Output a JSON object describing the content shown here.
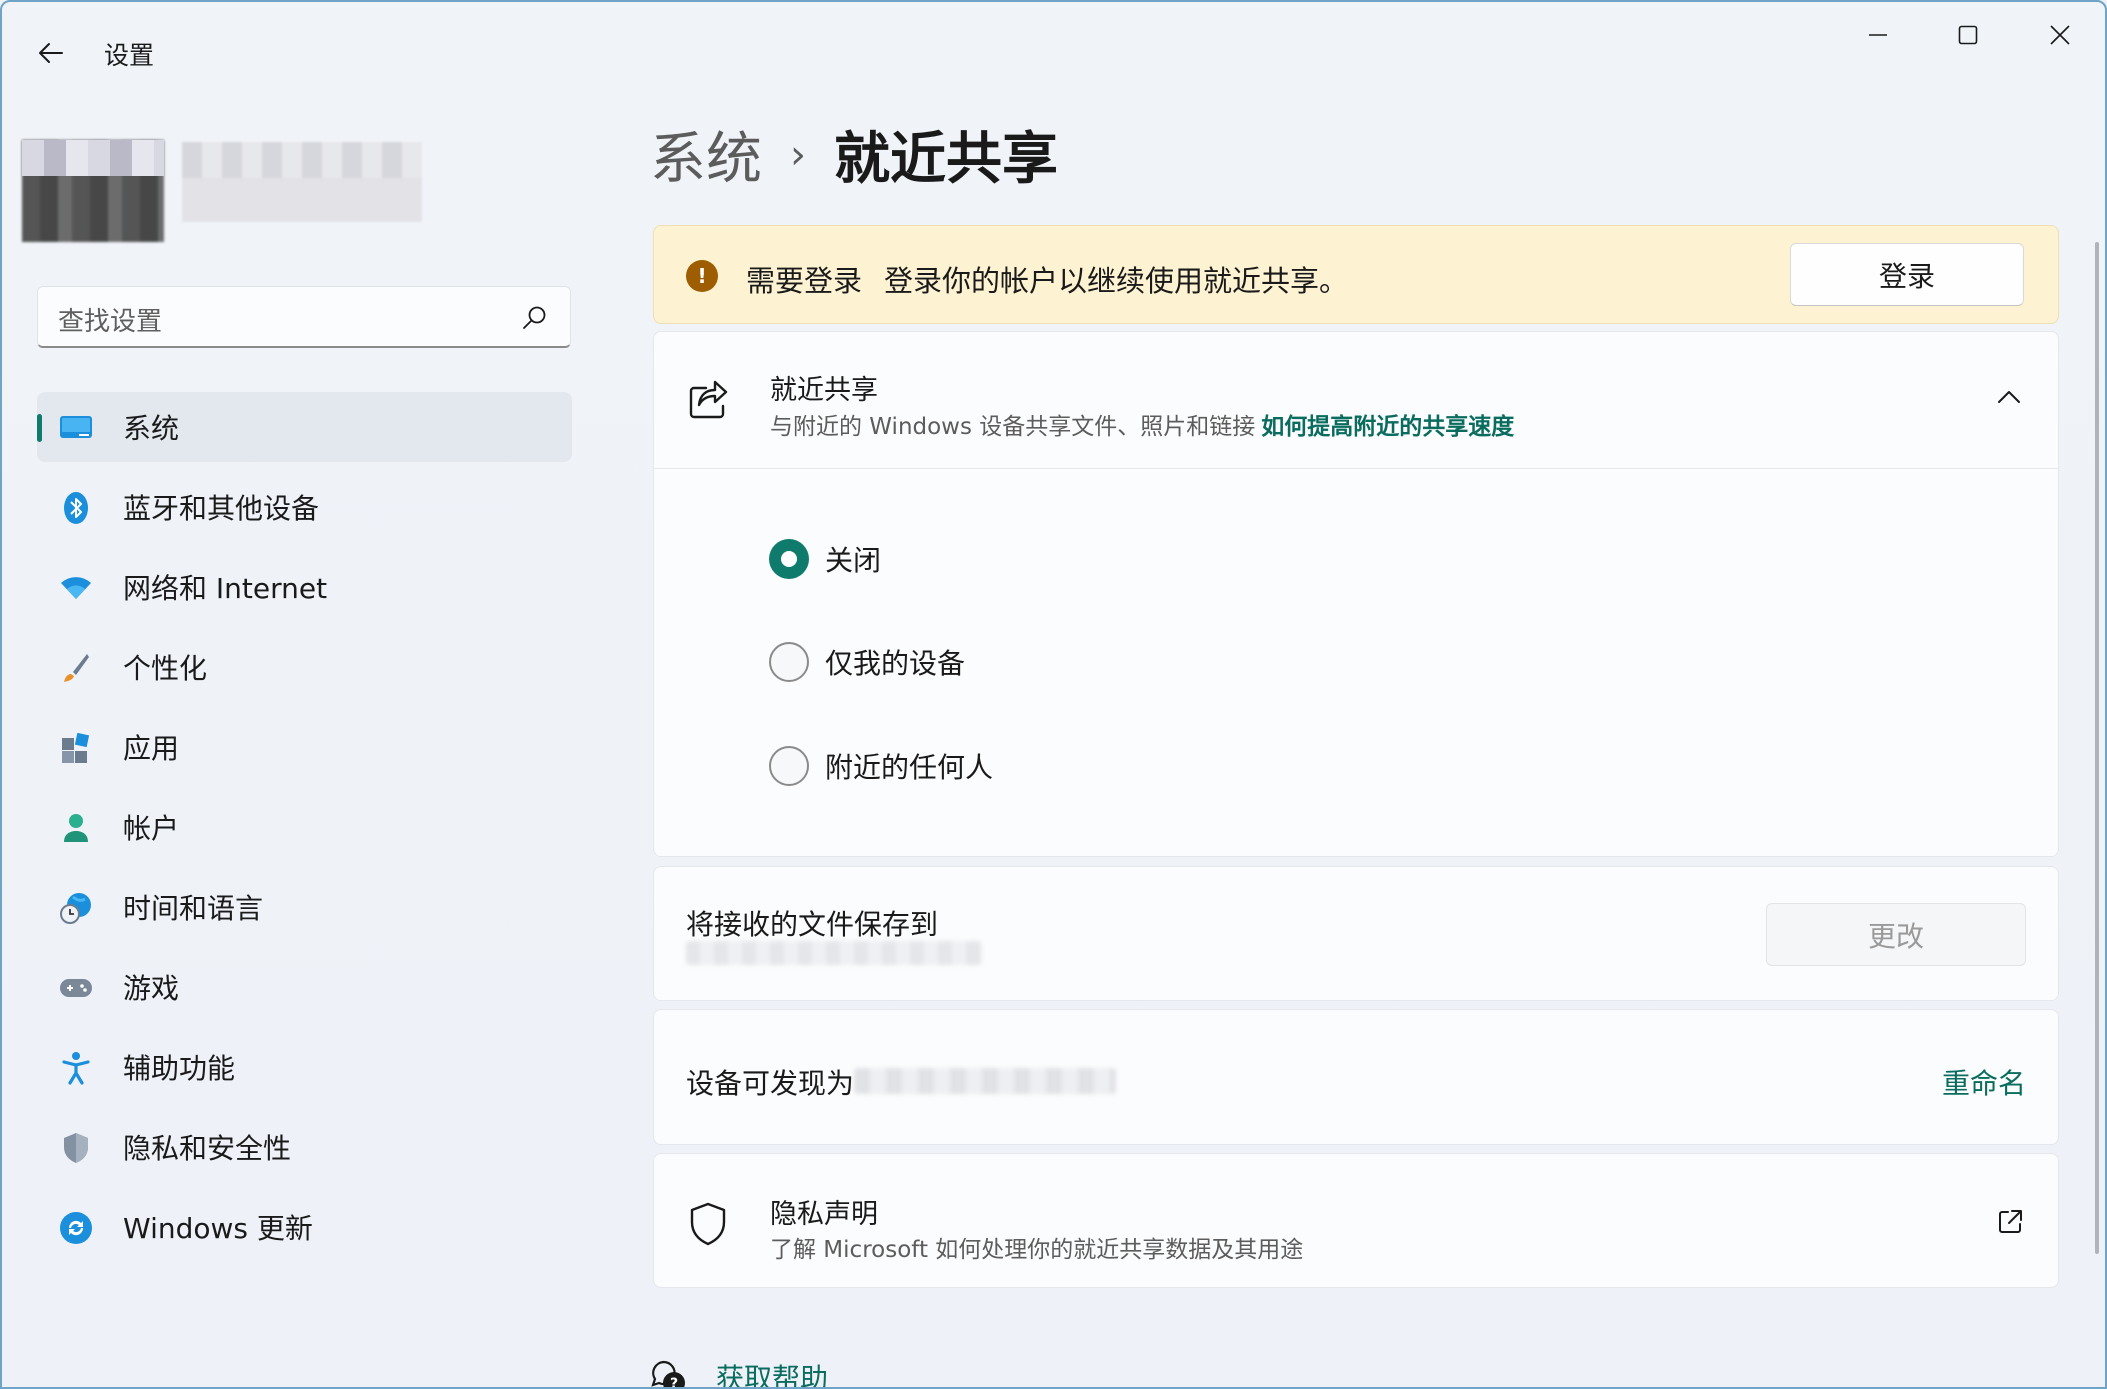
{
  "window": {
    "app_title": "设置"
  },
  "sidebar": {
    "search_placeholder": "查找设置",
    "items": [
      {
        "label": "系统",
        "icon": "monitor-icon"
      },
      {
        "label": "蓝牙和其他设备",
        "icon": "bluetooth-icon"
      },
      {
        "label": "网络和 Internet",
        "icon": "wifi-icon"
      },
      {
        "label": "个性化",
        "icon": "brush-icon"
      },
      {
        "label": "应用",
        "icon": "apps-icon"
      },
      {
        "label": "帐户",
        "icon": "account-icon"
      },
      {
        "label": "时间和语言",
        "icon": "globe-clock-icon"
      },
      {
        "label": "游戏",
        "icon": "gamepad-icon"
      },
      {
        "label": "辅助功能",
        "icon": "accessibility-icon"
      },
      {
        "label": "隐私和安全性",
        "icon": "shield-icon"
      },
      {
        "label": "Windows 更新",
        "icon": "update-icon"
      }
    ],
    "active_index": 0
  },
  "breadcrumb": {
    "parent": "系统",
    "separator": "›",
    "current": "就近共享"
  },
  "banner": {
    "title": "需要登录",
    "message": "登录你的帐户以继续使用就近共享。",
    "button": "登录",
    "icon_symbol": "!"
  },
  "nearby_share": {
    "title": "就近共享",
    "description": "与附近的 Windows 设备共享文件、照片和链接",
    "link": "如何提高附近的共享速度",
    "options": [
      {
        "label": "关闭",
        "selected": true
      },
      {
        "label": "仅我的设备",
        "selected": false
      },
      {
        "label": "附近的任何人",
        "selected": false
      }
    ]
  },
  "save_location": {
    "title": "将接收的文件保存到",
    "button": "更改"
  },
  "discoverable": {
    "label": "设备可发现为",
    "rename": "重命名"
  },
  "privacy": {
    "title": "隐私声明",
    "description": "了解 Microsoft 如何处理你的就近共享数据及其用途"
  },
  "help": {
    "label": "获取帮助"
  },
  "colors": {
    "accent": "#0f7b6c",
    "banner_bg": "#fdf3d3",
    "warning": "#9d5d00",
    "link": "#0a6c5e"
  }
}
